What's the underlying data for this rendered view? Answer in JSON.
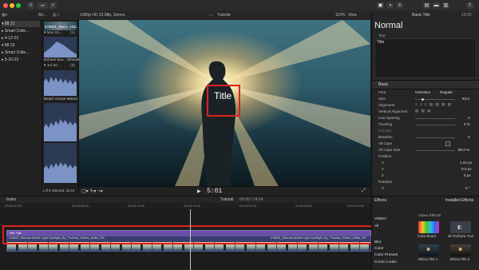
{
  "toolbar": {
    "traffic_colors": [
      "#ff5f57",
      "#febc2e",
      "#28c840"
    ]
  },
  "header": {
    "library_menu": "All...",
    "format": "1080p HD 23.98p, Stereo",
    "project_title": "Tutorial",
    "zoom": "115%",
    "view_label": "View",
    "inspector_tab": "Basic Title",
    "inspector_time": "10:00"
  },
  "library": {
    "items": [
      {
        "label": "▾ 88 21",
        "selected": true
      },
      {
        "label": "▸ Smart Colle...",
        "selected": false
      },
      {
        "label": "▸ 4-12-23",
        "selected": false
      },
      {
        "label": "▾ 88 23",
        "selected": false
      },
      {
        "label": "▸ Smart Colle...",
        "selected": false
      },
      {
        "label": "▸ 5-10-23",
        "selected": false
      }
    ]
  },
  "browser": {
    "clip1_label": "476831_Wom...Hist...HD",
    "date1": "▾ Nov 24,...",
    "date1_count": "(1)",
    "clip2_label": "Echoes Sca... Whoosh",
    "date2": "▾ Jul 20,...",
    "date2_count": "(2)",
    "clip3_label": "Beach Ocean Waves",
    "status": "1 of 6 selected, 33:18"
  },
  "viewer": {
    "overlay_title": "Title",
    "timecode": "5:01"
  },
  "inspector": {
    "title_label": "Normal",
    "text_section": "Text",
    "text_value": "Title",
    "basic_section": "Basic",
    "rows": [
      {
        "label": "Font",
        "value": "Helvetica",
        "value2": "Regular"
      },
      {
        "label": "Size",
        "value": "63.0"
      },
      {
        "label": "Alignment",
        "value": ""
      },
      {
        "label": "Vertical Alignment",
        "value": ""
      },
      {
        "label": "Line Spacing",
        "value": "0"
      },
      {
        "label": "Tracking",
        "value": "0 %"
      },
      {
        "label": "Kerning",
        "value": ""
      },
      {
        "label": "Baseline",
        "value": "0"
      },
      {
        "label": "All Caps",
        "value": ""
      },
      {
        "label": "All Caps Size",
        "value": "80.0 %"
      },
      {
        "label": "Position",
        "value": ""
      },
      {
        "label": "X",
        "value": "1.02 px"
      },
      {
        "label": "Y",
        "value": "9.0 px"
      },
      {
        "label": "Z",
        "value": "0 px"
      },
      {
        "label": "Rotation",
        "value": ""
      },
      {
        "label": "X",
        "value": "0 °"
      }
    ]
  },
  "timeline": {
    "index_label": "Index",
    "project": "Tutorial",
    "duration": "00:00 / 14:14",
    "title_clip": "Title Title",
    "video_clip_left": "476831_Woman-Model-Light-Spotlight_By_Thomas_Gellert_Artlist_HD",
    "video_clip_right": "476831_Woman-Model-Light-Spotlight_By_Thomas_Gellert_Artlist_HD",
    "ruler": [
      "00:00:00:00",
      "00:00:05:00",
      "00:00:10:00",
      "00:00:15:00",
      "00:00:20:00",
      "00:00:25:00",
      "00:00:30:00"
    ]
  },
  "effects": {
    "header": "Effects",
    "installed": "Installed Effects",
    "categories": [
      "VIDEO",
      "All",
      "Color",
      "Blur",
      "Color Presets",
      "Comic Looks"
    ],
    "section": "Video Effects",
    "items": [
      {
        "label": "Color Board"
      },
      {
        "label": "4k Profiume Tool"
      },
      {
        "label": "Rhino Film 1"
      },
      {
        "label": "Rhino Film 2"
      }
    ]
  }
}
